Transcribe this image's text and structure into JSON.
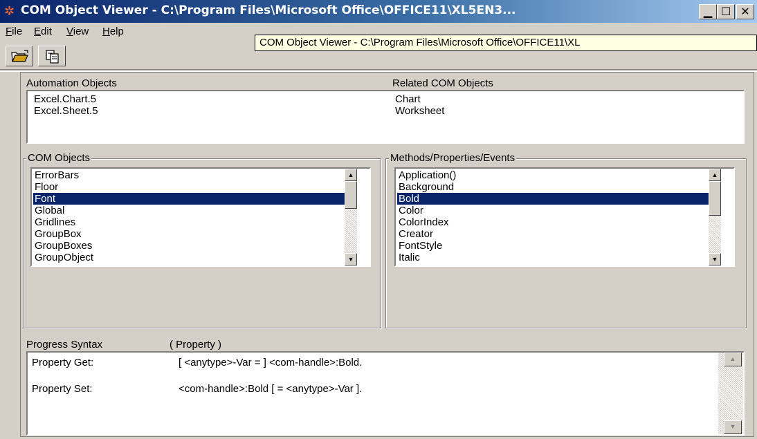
{
  "window": {
    "title": "COM Object Viewer - C:\\Program Files\\Microsoft Office\\OFFICE11\\XL5EN3...",
    "tooltip": "COM Object Viewer - C:\\Program Files\\Microsoft Office\\OFFICE11\\XL",
    "caption_buttons": [
      "minimize-icon",
      "maximize-icon",
      "close-icon"
    ]
  },
  "menu": {
    "file": {
      "accel": "F",
      "rest": "ile"
    },
    "edit": {
      "accel": "E",
      "rest": "dit"
    },
    "view": {
      "accel": "V",
      "rest": "iew"
    },
    "help": {
      "accel": "H",
      "rest": "elp"
    }
  },
  "toolbar": {
    "icons": [
      "open-folder-icon",
      "copy-icon"
    ]
  },
  "automation": {
    "header_left": "Automation Objects",
    "header_right": "Related COM Objects",
    "rows": [
      {
        "name": "Excel.Chart.5",
        "related": "Chart"
      },
      {
        "name": "Excel.Sheet.5",
        "related": "Worksheet"
      }
    ]
  },
  "com_objects": {
    "legend": "COM Objects",
    "items": [
      "ErrorBars",
      "Floor",
      "Font",
      "Global",
      "Gridlines",
      "GroupBox",
      "GroupBoxes",
      "GroupObject"
    ],
    "selected": "Font"
  },
  "members": {
    "legend": "Methods/Properties/Events",
    "items": [
      "Application()",
      "Background",
      "Bold",
      "Color",
      "ColorIndex",
      "Creator",
      "FontStyle",
      "Italic"
    ],
    "selected": "Bold"
  },
  "syntax": {
    "label": "Progress Syntax",
    "kind": "( Property )",
    "get_label": "Property Get:",
    "get_value": "[ <anytype>-Var = ] <com-handle>:Bold.",
    "set_label": "Property Set:",
    "set_value": "<com-handle>:Bold [ = <anytype>-Var ]."
  },
  "colors": {
    "titlebar": "#0a246a",
    "selection": "#0a246a",
    "chrome": "#d4d0c8",
    "desktop": "#ffff99"
  }
}
